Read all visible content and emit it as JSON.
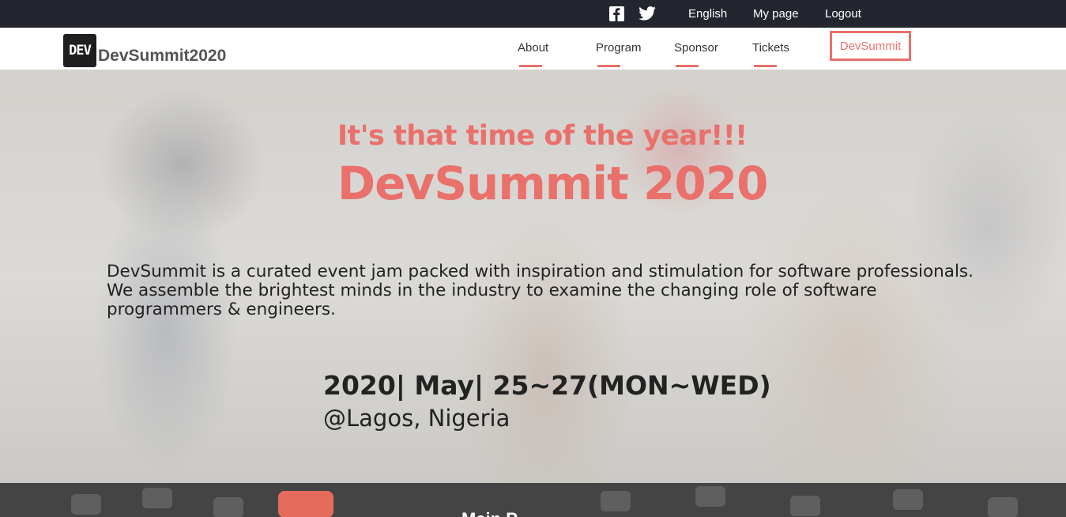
{
  "topbar": {
    "social": [
      "facebook-icon",
      "twitter-icon"
    ],
    "links": {
      "english": "English",
      "mypage": "My page",
      "logout": "Logout"
    }
  },
  "brand": {
    "badge": "DEV",
    "name": "DevSummit2020"
  },
  "nav": {
    "items": [
      "About",
      "Program",
      "Sponsor",
      "Tickets"
    ],
    "cta": "DevSummit"
  },
  "hero": {
    "subtitle": "It's that time of the year!!!",
    "title": "DevSummit 2020",
    "description": "DevSummit is a curated event jam packed with inspiration and stimulation for software professionals. We assemble the brightest minds in the industry to examine the changing role of software programmers & engineers.",
    "date": "2020| May| 25~27(MON~WED)",
    "location": "@Lagos, Nigeria"
  },
  "next_section": {
    "heading_partial": "Main P"
  },
  "colors": {
    "accent": "#e9706b",
    "topbar": "#23262e"
  }
}
